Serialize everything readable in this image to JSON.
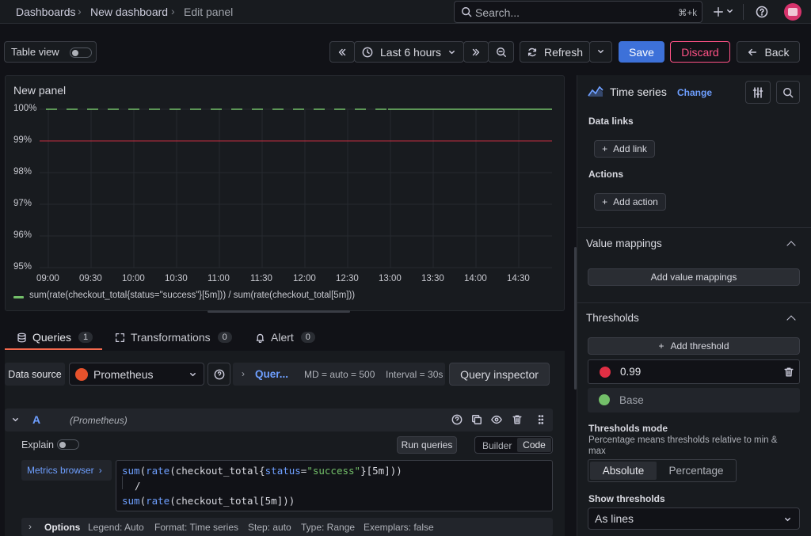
{
  "breadcrumb": {
    "dashboards": "Dashboards",
    "new_dashboard": "New dashboard",
    "edit_panel": "Edit panel",
    "sep": "›"
  },
  "search": {
    "placeholder": "Search...",
    "shortcut": "⌘+k"
  },
  "toolbar": {
    "table_view": "Table view",
    "time_range": "Last 6 hours",
    "refresh": "Refresh",
    "save": "Save",
    "discard": "Discard",
    "back": "Back"
  },
  "panel": {
    "title": "New panel",
    "legend": "sum(rate(checkout_total{status=\"success\"}[5m])) / sum(rate(checkout_total[5m]))"
  },
  "chart_data": {
    "type": "line",
    "x": [
      "09:00",
      "09:30",
      "10:00",
      "10:30",
      "11:00",
      "11:30",
      "12:00",
      "12:30",
      "13:00",
      "13:30",
      "14:00",
      "14:30"
    ],
    "y_ticks": [
      "100%",
      "99%",
      "98%",
      "97%",
      "96%",
      "95%"
    ],
    "ylim": [
      95,
      100
    ],
    "series": [
      {
        "values": [
          100,
          100,
          100,
          100,
          100,
          100,
          100,
          100,
          100,
          100,
          100,
          100
        ],
        "color": "#73bf69"
      }
    ],
    "threshold": {
      "value": 99,
      "color": "#e02f44"
    }
  },
  "query_tabs": [
    {
      "label": "Queries",
      "count": "1"
    },
    {
      "label": "Transformations",
      "count": "0"
    },
    {
      "label": "Alert",
      "count": "0"
    }
  ],
  "datasource": {
    "label": "Data source",
    "value": "Prometheus",
    "options_label": "Quer...",
    "md": "MD = auto = 500",
    "interval": "Interval = 30s",
    "inspector": "Query inspector"
  },
  "query": {
    "ref": "A",
    "source": "(Prometheus)",
    "explain": "Explain",
    "run": "Run queries",
    "builder": "Builder",
    "code": "Code",
    "metrics_browser": "Metrics browser",
    "line1_fn": "sum",
    "line1_rate": "rate",
    "line1_metric": "checkout_total",
    "line1_label": "status",
    "line1_value": "\"success\"",
    "line1_range": "5m",
    "line2": "/",
    "line3_fn": "sum",
    "line3_rate": "rate",
    "line3_metric": "checkout_total",
    "line3_range": "5m",
    "options": "Options",
    "opt_legend": "Legend: Auto",
    "opt_format": "Format: Time series",
    "opt_step": "Step: auto",
    "opt_type": "Type: Range",
    "opt_exemplars": "Exemplars: false"
  },
  "right": {
    "viz": "Time series",
    "change": "Change",
    "data_links": "Data links",
    "add_link": "Add link",
    "actions": "Actions",
    "add_action": "Add action",
    "value_mappings": "Value mappings",
    "add_value_mappings": "Add value mappings",
    "thresholds": "Thresholds",
    "add_threshold": "Add threshold",
    "threshold_value": "0.99",
    "base": "Base",
    "thresholds_mode": "Thresholds mode",
    "thresholds_mode_desc": "Percentage means thresholds relative to min & max",
    "absolute": "Absolute",
    "percentage": "Percentage",
    "show_thresholds": "Show thresholds",
    "as_lines": "As lines"
  },
  "colors": {
    "accent": "#3d71d9",
    "discard": "#ff5286",
    "green": "#73bf69",
    "red": "#e02f44"
  }
}
